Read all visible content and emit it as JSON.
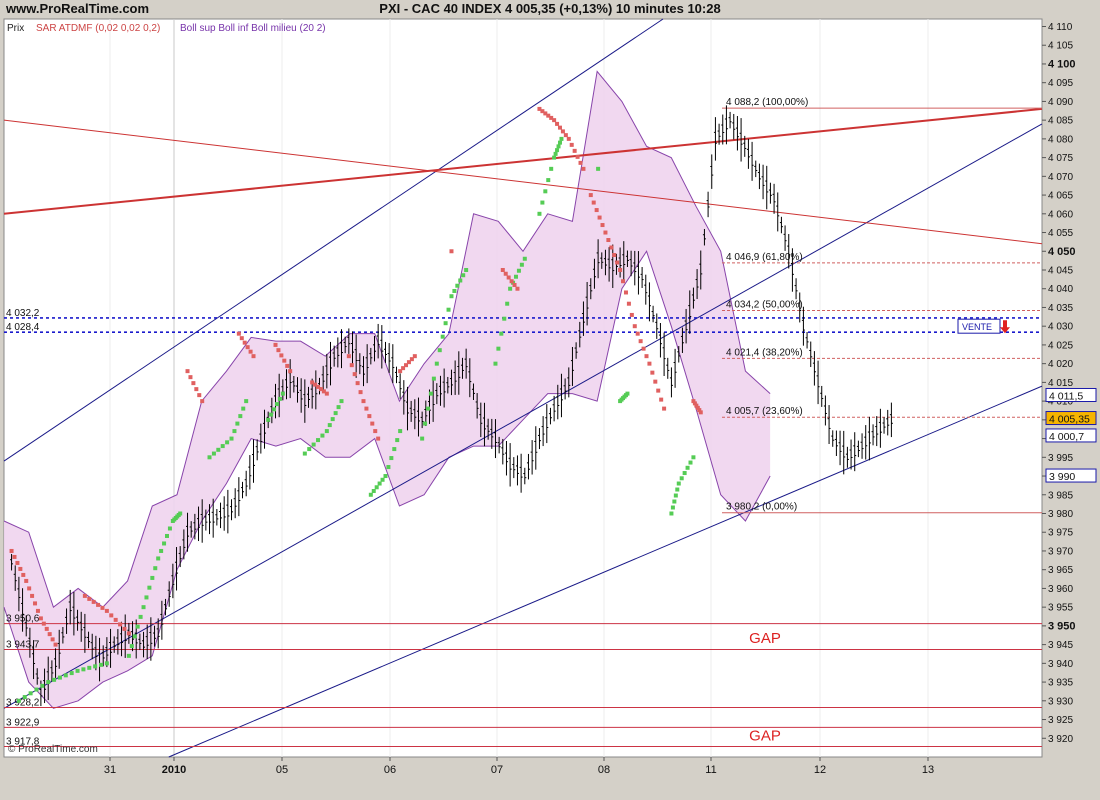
{
  "header": {
    "site": "www.ProRealTime.com",
    "title": "PXI - CAC 40 INDEX     4 005,35 (+0,13%)     10 minutes  10:28"
  },
  "legend": {
    "prix": "Prix",
    "sar": "SAR ATDMF (0,02 0,02 0,2)",
    "boll": "Boll sup Boll inf Boll milieu (20 2)"
  },
  "footer": {
    "copyright": "© ProRealTime.com"
  },
  "colors": {
    "background": "#ffffff",
    "panel": "#d4d0c8",
    "price": "#000000",
    "sar_up": "#55cc55",
    "sar_down": "#e06060",
    "boll_fill": "#f0d4ee",
    "boll_line": "#8844aa",
    "trend_blue": "#1a1a88",
    "trend_red": "#cc3333",
    "h_line": "#cc3344",
    "fib_line": "#d06060",
    "dotted_blue": "#1a1acc"
  },
  "chart_data": {
    "type": "line",
    "title": "PXI - CAC 40 INDEX",
    "timeframe": "10 minutes",
    "ylim": [
      3915,
      4112
    ],
    "yticks": [
      3920,
      3925,
      3930,
      3935,
      3940,
      3945,
      3950,
      3955,
      3960,
      3965,
      3970,
      3975,
      3980,
      3985,
      3990,
      3995,
      4000,
      4005,
      4010,
      4015,
      4020,
      4025,
      4030,
      4035,
      4040,
      4045,
      4050,
      4055,
      4060,
      4065,
      4070,
      4075,
      4080,
      4085,
      4090,
      4095,
      4100,
      4105,
      4110
    ],
    "ytick_labels": [
      "3 920",
      "3 925",
      "3 930",
      "3 935",
      "3 940",
      "3 945",
      "3 950",
      "3 955",
      "3 960",
      "3 965",
      "3 970",
      "3 975",
      "3 980",
      "3 985",
      "3 990",
      "3 995",
      "4 000",
      "4 005",
      "4 010",
      "4 015",
      "4 020",
      "4 025",
      "4 030",
      "4 035",
      "4 040",
      "4 045",
      "4 050",
      "4 055",
      "4 060",
      "4 065",
      "4 070",
      "4 075",
      "4 080",
      "4 085",
      "4 090",
      "4 095",
      "4 100",
      "4 105",
      "4 110"
    ],
    "bold_yticks": [
      3950,
      4050,
      4100
    ],
    "x_labels": [
      "31",
      "2010",
      "05",
      "06",
      "07",
      "08",
      "11",
      "12",
      "13"
    ],
    "bold_x_labels": [
      "2010"
    ],
    "price": {
      "name": "Prix",
      "x": [
        0,
        2,
        4,
        6,
        8,
        10,
        12,
        14,
        16,
        18,
        20,
        22,
        24,
        26,
        28,
        30,
        32,
        34,
        36,
        38,
        40,
        42,
        44,
        46,
        48,
        50,
        52,
        54,
        56,
        58,
        60,
        62,
        64,
        66,
        68,
        70,
        72,
        74,
        76,
        78,
        80,
        82,
        84,
        86,
        88,
        90,
        92,
        94,
        96,
        98,
        100
      ],
      "y": [
        3967,
        3950,
        3932,
        3940,
        3955,
        3948,
        3941,
        3945,
        3948,
        3945,
        3948,
        3962,
        3975,
        3978,
        3979,
        3981,
        3988,
        4000,
        4010,
        4016,
        4010,
        4014,
        4022,
        4026,
        4018,
        4026,
        4020,
        4008,
        4005,
        4012,
        4015,
        4020,
        4005,
        4000,
        3993,
        3990,
        4000,
        4008,
        4015,
        4032,
        4048,
        4046,
        4048,
        4043,
        4030,
        4015,
        4030,
        4045,
        4080,
        4085,
        4078
      ]
    },
    "price_tail": {
      "x": [
        100,
        102,
        104,
        106,
        108,
        110,
        112,
        114,
        116,
        118,
        120
      ],
      "y": [
        4078,
        4070,
        4064,
        4050,
        4030,
        4015,
        4000,
        3995,
        3998,
        4002,
        4005
      ]
    },
    "sar": {
      "name": "SAR ATDMF",
      "up_segments": [
        [
          [
            1,
            3930
          ],
          [
            5,
            3935
          ],
          [
            9,
            3938
          ],
          [
            13,
            3940
          ]
        ],
        [
          [
            16,
            3942
          ],
          [
            18,
            3955
          ],
          [
            20,
            3968
          ],
          [
            22,
            3978
          ],
          [
            23,
            3980
          ]
        ],
        [
          [
            27,
            3995
          ],
          [
            30,
            4000
          ],
          [
            32,
            4010
          ]
        ],
        [
          [
            35,
            4005
          ],
          [
            37,
            4012
          ]
        ],
        [
          [
            40,
            3996
          ],
          [
            43,
            4002
          ],
          [
            45,
            4010
          ]
        ],
        [
          [
            49,
            3985
          ],
          [
            51,
            3990
          ],
          [
            53,
            4002
          ]
        ],
        [
          [
            56,
            4000
          ],
          [
            58,
            4020
          ],
          [
            60,
            4038
          ],
          [
            62,
            4045
          ]
        ],
        [
          [
            66,
            4020
          ],
          [
            68,
            4040
          ],
          [
            70,
            4048
          ]
        ],
        [
          [
            72,
            4060
          ],
          [
            74,
            4075
          ],
          [
            75,
            4080
          ]
        ],
        [
          [
            80,
            4072
          ]
        ],
        [
          [
            83,
            4010
          ],
          [
            84,
            4012
          ]
        ],
        [
          [
            90,
            3980
          ],
          [
            91,
            3988
          ],
          [
            93,
            3995
          ]
        ]
      ],
      "down_segments": [
        [
          [
            0,
            3970
          ],
          [
            2,
            3962
          ],
          [
            4,
            3952
          ],
          [
            6,
            3945
          ]
        ],
        [
          [
            10,
            3958
          ],
          [
            13,
            3954
          ],
          [
            16,
            3948
          ]
        ],
        [
          [
            24,
            4018
          ],
          [
            26,
            4010
          ]
        ],
        [
          [
            31,
            4028
          ],
          [
            33,
            4022
          ]
        ],
        [
          [
            36,
            4025
          ],
          [
            38,
            4018
          ]
        ],
        [
          [
            41,
            4015
          ],
          [
            43,
            4012
          ]
        ],
        [
          [
            46,
            4022
          ],
          [
            48,
            4010
          ],
          [
            50,
            4000
          ]
        ],
        [
          [
            53,
            4018
          ],
          [
            55,
            4022
          ]
        ],
        [
          [
            60,
            4050
          ]
        ],
        [
          [
            67,
            4045
          ],
          [
            69,
            4040
          ]
        ],
        [
          [
            72,
            4088
          ],
          [
            74,
            4085
          ],
          [
            76,
            4080
          ],
          [
            78,
            4072
          ]
        ],
        [
          [
            79,
            4065
          ],
          [
            81,
            4055
          ],
          [
            83,
            4045
          ],
          [
            85,
            4030
          ],
          [
            87,
            4020
          ],
          [
            89,
            4008
          ]
        ],
        [
          [
            93,
            4010
          ],
          [
            94,
            4007
          ]
        ]
      ]
    },
    "bollinger": {
      "name": "Boll sup Boll inf Boll milieu (20 2)",
      "upper_x": [
        0,
        3,
        6,
        9,
        12,
        15,
        18,
        21,
        24,
        27,
        30,
        33,
        36,
        39,
        42,
        45,
        48,
        51,
        54,
        57,
        60,
        63,
        66,
        69,
        72,
        75,
        78,
        81,
        84,
        87,
        90,
        93
      ],
      "upper_y": [
        3978,
        3975,
        3955,
        3960,
        3955,
        3962,
        3982,
        3985,
        4010,
        4018,
        4027,
        4026,
        4026,
        4022,
        4028,
        4028,
        4010,
        4020,
        4028,
        4060,
        4058,
        4050,
        4060,
        4058,
        4098,
        4090,
        4078,
        4075,
        4062,
        4050,
        4018,
        4012
      ],
      "lower_x": [
        0,
        3,
        6,
        9,
        12,
        15,
        18,
        21,
        24,
        27,
        30,
        33,
        36,
        39,
        42,
        45,
        48,
        51,
        54,
        57,
        60,
        63,
        66,
        69,
        72,
        75,
        78,
        81,
        84,
        87,
        90,
        93
      ],
      "lower_y": [
        3955,
        3935,
        3928,
        3930,
        3935,
        3938,
        3942,
        3965,
        3978,
        3988,
        4000,
        3998,
        4000,
        3995,
        3995,
        4000,
        3982,
        3985,
        3995,
        3998,
        3998,
        4005,
        4012,
        4012,
        4010,
        4040,
        4050,
        4030,
        4008,
        3985,
        3978,
        3990
      ]
    },
    "horizontal_lines": [
      {
        "label": "4 032,2",
        "y": 4032.2,
        "style": "dotted"
      },
      {
        "label": "4 028,4",
        "y": 4028.4,
        "style": "dotted"
      },
      {
        "label": "3 950,6",
        "y": 3950.6,
        "style": "solid"
      },
      {
        "label": "3 943,7",
        "y": 3943.7,
        "style": "solid"
      },
      {
        "label": "3 928,2",
        "y": 3928.2,
        "style": "solid"
      },
      {
        "label": "3 922,9",
        "y": 3922.9,
        "style": "solid"
      },
      {
        "label": "3 917,8",
        "y": 3917.8,
        "style": "solid"
      }
    ],
    "fibonacci": [
      {
        "label": "4 088,2 (100,00%)",
        "y": 4088.2
      },
      {
        "label": "4 046,9 (61,80%)",
        "y": 4046.9
      },
      {
        "label": "4 034,2 (50,00%)",
        "y": 4034.2
      },
      {
        "label": "4 021,4 (38,20%)",
        "y": 4021.4
      },
      {
        "label": "4 005,7 (23,60%)",
        "y": 4005.7
      },
      {
        "label": "3 980,2 (0,00%)",
        "y": 3980.2
      }
    ],
    "price_boxes": [
      {
        "label": "4 011,5",
        "y": 4011.5,
        "highlight": false
      },
      {
        "label": "4 005,35",
        "y": 4005.35,
        "highlight": true
      },
      {
        "label": "4 000,7",
        "y": 4000.7,
        "highlight": false
      },
      {
        "label": "3 990",
        "y": 3990,
        "highlight": false
      }
    ],
    "annotations": [
      {
        "text": "GAP",
        "y": 3947
      },
      {
        "text": "GAP",
        "y": 3921
      }
    ],
    "signal": {
      "text": "VENTE",
      "y": 4030
    }
  }
}
